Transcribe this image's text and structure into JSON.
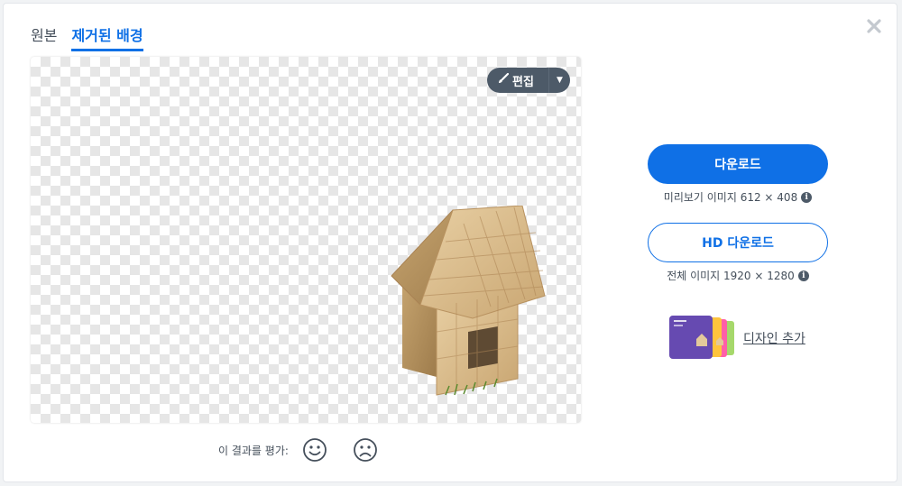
{
  "tabs": [
    {
      "label": "원본",
      "active": false
    },
    {
      "label": "제거된 배경",
      "active": true
    }
  ],
  "editor": {
    "edit_label": "편집",
    "edit_icon": "brush-icon",
    "caret_icon": "caret-down-icon"
  },
  "rating": {
    "label": "이 결과를 평가:",
    "positive_icon": "smile-icon",
    "negative_icon": "frown-icon"
  },
  "download": {
    "primary_label": "다운로드",
    "preview_caption": "미리보기 이미지 612 × 408",
    "hd_label": "HD 다운로드",
    "hd_caption": "전체 이미지 1920 × 1280"
  },
  "design": {
    "label": "디자인 추가"
  },
  "colors": {
    "accent": "#0f70e6",
    "text": "#454f5b",
    "edit_button": "#4d5a68"
  }
}
